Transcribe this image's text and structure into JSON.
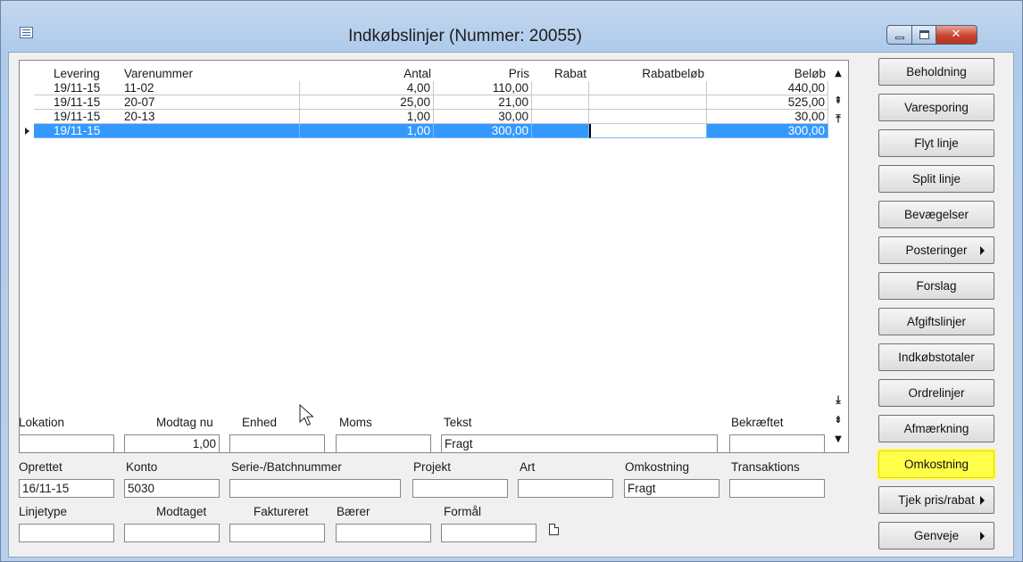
{
  "window": {
    "title": "Indkøbslinjer (Nummer: 20055)",
    "close_glyph": "✕"
  },
  "grid": {
    "columns": {
      "levering": "Levering",
      "varenummer": "Varenummer",
      "antal": "Antal",
      "pris": "Pris",
      "rabat": "Rabat",
      "rabatbelob": "Rabatbeløb",
      "belob": "Beløb"
    },
    "rows": [
      {
        "levering": "19/11-15",
        "varenummer": "11-02",
        "antal": "4,00",
        "pris": "110,00",
        "rabat": "",
        "rabatbelob": "",
        "belob": "440,00"
      },
      {
        "levering": "19/11-15",
        "varenummer": "20-07",
        "antal": "25,00",
        "pris": "21,00",
        "rabat": "",
        "rabatbelob": "",
        "belob": "525,00"
      },
      {
        "levering": "19/11-15",
        "varenummer": "20-13",
        "antal": "1,00",
        "pris": "30,00",
        "rabat": "",
        "rabatbelob": "",
        "belob": "30,00"
      },
      {
        "levering": "19/11-15",
        "varenummer": "",
        "antal": "1,00",
        "pris": "300,00",
        "rabat": "",
        "rabatbelob": "",
        "belob": "300,00"
      }
    ],
    "selected_row_index": 3,
    "scroll_glyphs": {
      "up": "▲",
      "page_up": "⇞",
      "top": "⤒",
      "bottom": "⤓",
      "page_down": "⇟",
      "down": "▼"
    }
  },
  "form": {
    "labels": {
      "lokation": "Lokation",
      "modtag_nu": "Modtag nu",
      "enhed": "Enhed",
      "moms": "Moms",
      "tekst": "Tekst",
      "bekraeftet": "Bekræftet",
      "oprettet": "Oprettet",
      "konto": "Konto",
      "serie_batch": "Serie-/Batchnummer",
      "projekt": "Projekt",
      "art": "Art",
      "omkostning": "Omkostning",
      "transaktions": "Transaktions",
      "linjetype": "Linjetype",
      "modtaget": "Modtaget",
      "faktureret": "Faktureret",
      "baerer": "Bærer",
      "formal": "Formål"
    },
    "values": {
      "lokation": "",
      "modtag_nu": "1,00",
      "enhed": "",
      "moms": "",
      "tekst": "Fragt",
      "bekraeftet": "",
      "oprettet": "16/11-15",
      "konto": "5030",
      "serie_batch": "",
      "projekt": "",
      "art": "",
      "omkostning": "Fragt",
      "transaktions": "",
      "linjetype": "",
      "modtaget": "",
      "faktureret": "",
      "baerer": "",
      "formal": ""
    }
  },
  "side_buttons": [
    {
      "label": "Beholdning",
      "submenu": false,
      "highlighted": false
    },
    {
      "label": "Varesporing",
      "submenu": false,
      "highlighted": false
    },
    {
      "label": "Flyt linje",
      "submenu": false,
      "highlighted": false
    },
    {
      "label": "Split linje",
      "submenu": false,
      "highlighted": false
    },
    {
      "label": "Bevægelser",
      "submenu": false,
      "highlighted": false
    },
    {
      "label": "Posteringer",
      "submenu": true,
      "highlighted": false
    },
    {
      "label": "Forslag",
      "submenu": false,
      "highlighted": false
    },
    {
      "label": "Afgiftslinjer",
      "submenu": false,
      "highlighted": false
    },
    {
      "label": "Indkøbstotaler",
      "submenu": false,
      "highlighted": false
    },
    {
      "label": "Ordrelinjer",
      "submenu": false,
      "highlighted": false
    },
    {
      "label": "Afmærkning",
      "submenu": false,
      "highlighted": false
    },
    {
      "label": "Omkostning",
      "submenu": false,
      "highlighted": true
    },
    {
      "label": "Tjek pris/rabat",
      "submenu": true,
      "highlighted": false
    },
    {
      "label": "Genveje",
      "submenu": true,
      "highlighted": false
    }
  ],
  "colors": {
    "selection": "#3399ff",
    "highlight": "#ffff4a",
    "close_button": "#c7432f"
  }
}
